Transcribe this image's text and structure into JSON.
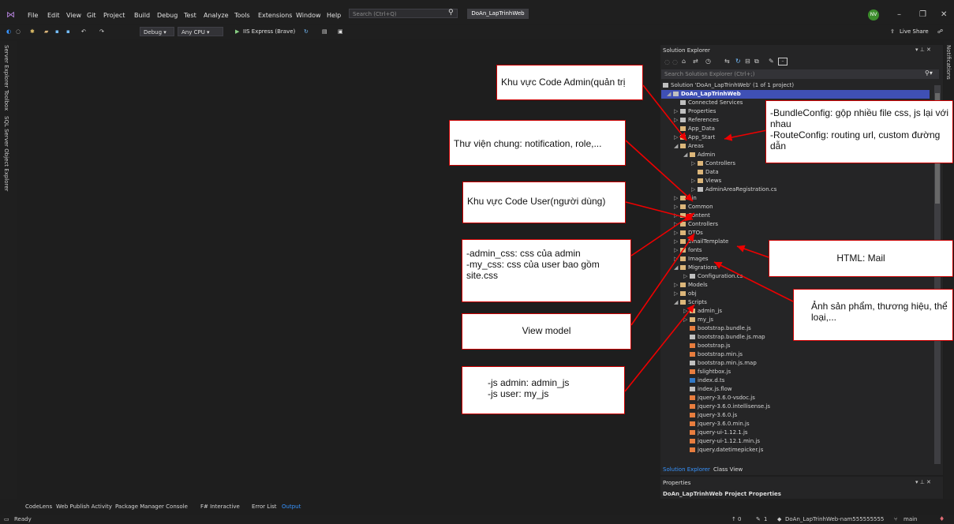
{
  "titlebar": {
    "menu": [
      "File",
      "Edit",
      "View",
      "Git",
      "Project",
      "Build",
      "Debug",
      "Test",
      "Analyze",
      "Tools",
      "Extensions",
      "Window",
      "Help"
    ],
    "search_placeholder": "Search (Ctrl+Q)",
    "solution_name": "DoAn_LapTrinhWeb",
    "avatar_initials": "NV"
  },
  "toolbar": {
    "config": "Debug",
    "platform": "Any CPU",
    "run_target": "IIS Express (Brave)",
    "live_share": "Live Share"
  },
  "left_rail": [
    "Server Explorer",
    "Toolbox",
    "SQL Server Object Explorer"
  ],
  "right_rail": "Notifications",
  "solution_explorer": {
    "title": "Solution Explorer",
    "search_placeholder": "Search Solution Explorer (Ctrl+;)",
    "items": [
      "Solution 'DoAn_LapTrinhWeb' (1 of 1 project)",
      "DoAn_LapTrinhWeb",
      "Connected Services",
      "Properties",
      "References",
      "App_Data",
      "App_Start",
      "Areas",
      "Admin",
      "Controllers",
      "Data",
      "Views",
      "AdminAreaRegistration.cs",
      "bin",
      "Common",
      "Content",
      "Controllers",
      "DTOs",
      "EmailTemplate",
      "fonts",
      "Images",
      "Migrations",
      "Configuration.cs",
      "Models",
      "obj",
      "Scripts",
      "admin_js",
      "my_js",
      "bootstrap.bundle.js",
      "bootstrap.bundle.js.map",
      "bootstrap.js",
      "bootstrap.min.js",
      "bootstrap.min.js.map",
      "fslightbox.js",
      "index.d.ts",
      "index.js.flow",
      "jquery-3.6.0-vsdoc.js",
      "jquery-3.6.0.intellisense.js",
      "jquery-3.6.0.js",
      "jquery-3.6.0.min.js",
      "jquery-ui-1.12.1.js",
      "jquery-ui-1.12.1.min.js",
      "jquery.datetimepicker.js"
    ],
    "tabs": [
      "Solution Explorer",
      "Class View"
    ]
  },
  "properties": {
    "title": "Properties",
    "subtitle": "DoAn_LapTrinhWeb  Project Properties"
  },
  "bottom_tabs": [
    "CodeLens",
    "Web Publish Activity",
    "Package Manager Console",
    "F# Interactive",
    "Error List",
    "Output"
  ],
  "status": {
    "ready": "Ready",
    "up": "0",
    "pencil": "1",
    "repo": "DoAn_LapTrinhWeb-nam555555555",
    "branch": "main"
  },
  "annotations": {
    "admin": "Khu vực Code Admin(quản trị",
    "bundle": "-BundleConfig: gộp nhiều file css, js lại với nhau\n-RouteConfig: routing url, custom đường dẫn",
    "common": "Thư viện chung: notification, role,...",
    "user": "Khu vực Code User(người dùng)",
    "content": "-admin_css: css của admin\n-my_css: css của user bao gồm site.css",
    "mail": "HTML: Mail",
    "images": "Ảnh sản phẩm, thương hiệu, thể loại,...",
    "viewmodel": "View model",
    "scripts": "-js admin: admin_js\n-js user: my_js"
  }
}
